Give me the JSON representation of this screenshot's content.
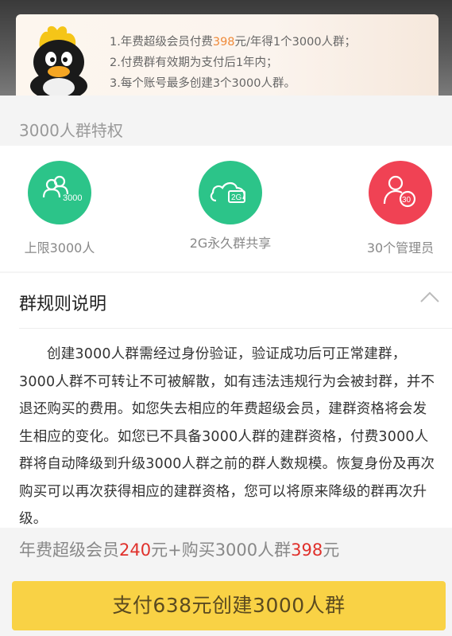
{
  "notes": {
    "line1_prefix": "1.年费超级会员付费",
    "line1_price": "398",
    "line1_suffix": "元/年得1个3000人群；",
    "line2": "2.付费群有效期为支付后1年内；",
    "line3": "3.每个账号最多创建3个3000人群。"
  },
  "privileges": {
    "title": "3000人群特权",
    "features": [
      {
        "label": "上限3000人",
        "icon": "group-3000-icon",
        "icon_text": "3000",
        "color": "#2cc489"
      },
      {
        "label": "2G永久群共享",
        "icon": "cloud-2g-icon",
        "icon_text": "2G",
        "color": "#2cc489"
      },
      {
        "label": "30个管理员",
        "icon": "admin-30-icon",
        "icon_text": "30",
        "color": "#f04254"
      }
    ]
  },
  "rules": {
    "title": "群规则说明",
    "body": "创建3000人群需经过身份验证，验证成功后可正常建群，3000人群不可转让不可被解散，如有违法违规行为会被封群，并不退还购买的费用。如您失去相应的年费超级会员，建群资格将会发生相应的变化。如您已不具备3000人群的建群资格，付费3000人群将自动降级到升级3000人群之前的群人数规模。恢复身份及再次购买可以再次获得相应的建群资格，您可以将原来降级的群再次升级。"
  },
  "price": {
    "part1": "年费超级会员",
    "amount1": "240",
    "part2": "元+购买3000人群",
    "amount2": "398",
    "part3": "元"
  },
  "pay_button": {
    "label": "支付638元创建3000人群"
  }
}
